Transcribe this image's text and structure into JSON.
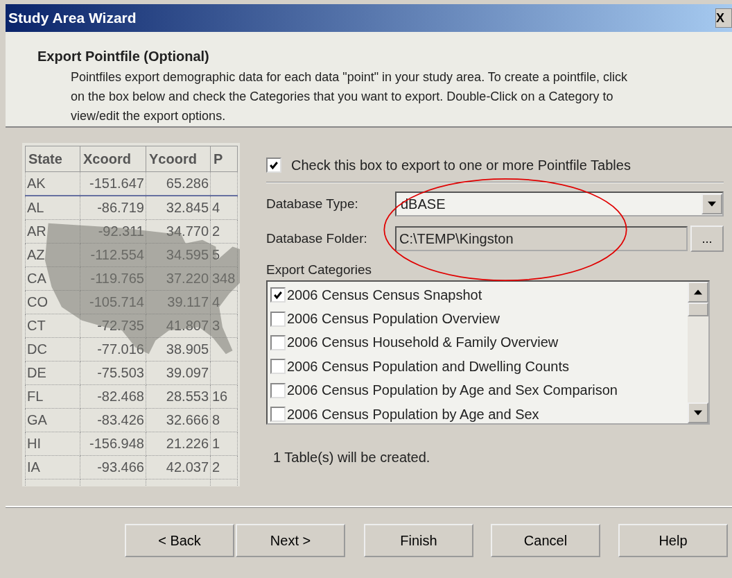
{
  "window": {
    "title": "Study Area Wizard",
    "close": "X"
  },
  "header": {
    "title": "Export Pointfile (Optional)",
    "description": "Pointfiles export demographic data for each data \"point\" in your study area.  To create a pointfile, click on the box below and check the Categories that you want to export. Double-Click on a Category to view/edit the export options."
  },
  "preview_table": {
    "columns": [
      "State",
      "Xcoord",
      "Ycoord",
      "P"
    ],
    "rows": [
      [
        "AK",
        "-151.647",
        "65.286",
        ""
      ],
      [
        "AL",
        "-86.719",
        "32.845",
        "4"
      ],
      [
        "AR",
        "-92.311",
        "34.770",
        "2"
      ],
      [
        "AZ",
        "-112.554",
        "34.595",
        "5"
      ],
      [
        "CA",
        "-119.765",
        "37.220",
        "348"
      ],
      [
        "CO",
        "-105.714",
        "39.117",
        "4"
      ],
      [
        "CT",
        "-72.735",
        "41.807",
        "3"
      ],
      [
        "DC",
        "-77.016",
        "38.905",
        ""
      ],
      [
        "DE",
        "-75.503",
        "39.097",
        ""
      ],
      [
        "FL",
        "-82.468",
        "28.553",
        "16"
      ],
      [
        "GA",
        "-83.426",
        "32.666",
        "8"
      ],
      [
        "HI",
        "-156.948",
        "21.226",
        "1"
      ],
      [
        "IA",
        "-93.466",
        "42.037",
        "2"
      ]
    ]
  },
  "export_checkbox": {
    "label": "Check this box to export to one or more Pointfile Tables",
    "checked": true
  },
  "database_type": {
    "label": "Database Type:",
    "value": "dBASE"
  },
  "database_folder": {
    "label": "Database Folder:",
    "value": "C:\\TEMP\\Kingston",
    "browse": "..."
  },
  "export_categories": {
    "label": "Export Categories",
    "items": [
      {
        "label": "2006 Census Census Snapshot",
        "checked": true
      },
      {
        "label": "2006 Census Population Overview",
        "checked": false
      },
      {
        "label": "2006 Census Household & Family Overview",
        "checked": false
      },
      {
        "label": "2006 Census Population and Dwelling Counts",
        "checked": false
      },
      {
        "label": "2006 Census Population by Age and Sex Comparison",
        "checked": false
      },
      {
        "label": "2006 Census Population by Age and Sex",
        "checked": false
      }
    ]
  },
  "status": "1 Table(s) will be created.",
  "buttons": [
    "< Back",
    "Next >",
    "Finish",
    "Cancel",
    "Help"
  ]
}
